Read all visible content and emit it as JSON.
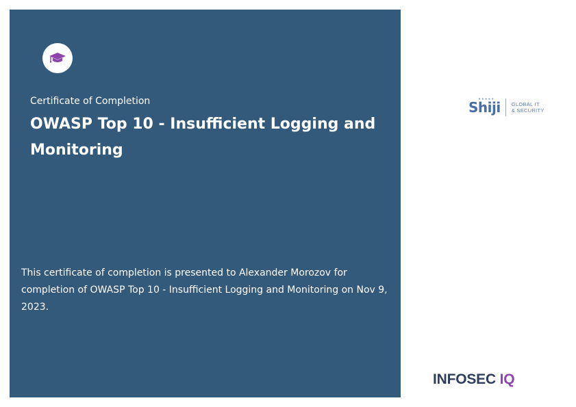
{
  "certificate": {
    "label": "Certificate of Completion",
    "course_title": "OWASP Top 10 - Insufficient Logging and Monitoring",
    "statement": "This certificate of completion is presented to Alexander Morozov for completion of OWASP Top 10 - Insufficient Logging and Monitoring on Nov 9, 2023.",
    "icon": "graduation-cap-icon"
  },
  "logos": {
    "shiji": {
      "name": "Shiji",
      "tagline_line1": "GLOBAL IT",
      "tagline_line2": "& SECURITY"
    },
    "infosec": {
      "word": "INFOSEC",
      "accent": "IQ"
    }
  },
  "colors": {
    "panel": "#335a7b",
    "panel_text": "#ffffff",
    "badge_icon": "#8e44ad",
    "infosec_text": "#2f3e5c",
    "iq_accent": "#8e44ad",
    "shiji_blue": "#4a6fa5"
  }
}
